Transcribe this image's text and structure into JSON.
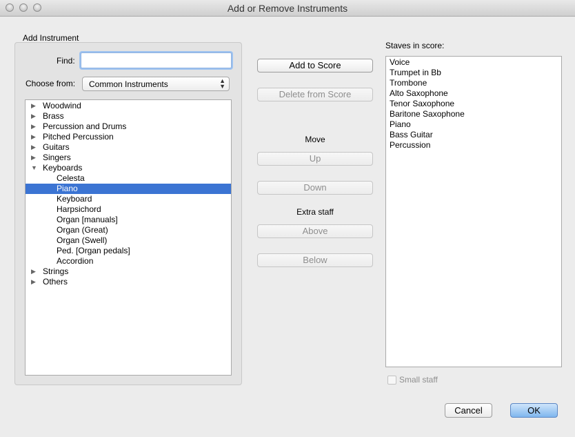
{
  "window": {
    "title": "Add or Remove Instruments",
    "controls": [
      "close-icon",
      "minimize-icon",
      "zoom-icon"
    ]
  },
  "add_instrument": {
    "group_label": "Add Instrument",
    "find_label": "Find:",
    "find_value": "",
    "choose_label": "Choose from:",
    "choose_value": "Common Instruments",
    "tree": [
      {
        "label": "Woodwind",
        "level": 0,
        "expanded": false
      },
      {
        "label": "Brass",
        "level": 0,
        "expanded": false
      },
      {
        "label": "Percussion and Drums",
        "level": 0,
        "expanded": false
      },
      {
        "label": "Pitched Percussion",
        "level": 0,
        "expanded": false
      },
      {
        "label": "Guitars",
        "level": 0,
        "expanded": false
      },
      {
        "label": "Singers",
        "level": 0,
        "expanded": false
      },
      {
        "label": "Keyboards",
        "level": 0,
        "expanded": true
      },
      {
        "label": "Celesta",
        "level": 1
      },
      {
        "label": "Piano",
        "level": 1,
        "selected": true
      },
      {
        "label": "Keyboard",
        "level": 1
      },
      {
        "label": "Harpsichord",
        "level": 1
      },
      {
        "label": "Organ [manuals]",
        "level": 1
      },
      {
        "label": "Organ (Great)",
        "level": 1
      },
      {
        "label": "Organ (Swell)",
        "level": 1
      },
      {
        "label": "Ped. [Organ pedals]",
        "level": 1
      },
      {
        "label": "Accordion",
        "level": 1
      },
      {
        "label": "Strings",
        "level": 0,
        "expanded": false
      },
      {
        "label": "Others",
        "level": 0,
        "expanded": false
      }
    ]
  },
  "actions": {
    "add_to_score": "Add to Score",
    "delete_from_score": "Delete from Score",
    "move_label": "Move",
    "up": "Up",
    "down": "Down",
    "extra_staff_label": "Extra staff",
    "above": "Above",
    "below": "Below"
  },
  "staves": {
    "label": "Staves in score:",
    "items": [
      "Voice",
      "Trumpet in Bb",
      "Trombone",
      "Alto Saxophone",
      "Tenor Saxophone",
      "Baritone Saxophone",
      "Piano",
      "Bass Guitar",
      "Percussion"
    ],
    "small_staff_label": "Small staff",
    "small_staff_checked": false
  },
  "footer": {
    "cancel": "Cancel",
    "ok": "OK"
  },
  "colors": {
    "selection": "#3b74d3",
    "ok_button": "#7fb6ee"
  }
}
